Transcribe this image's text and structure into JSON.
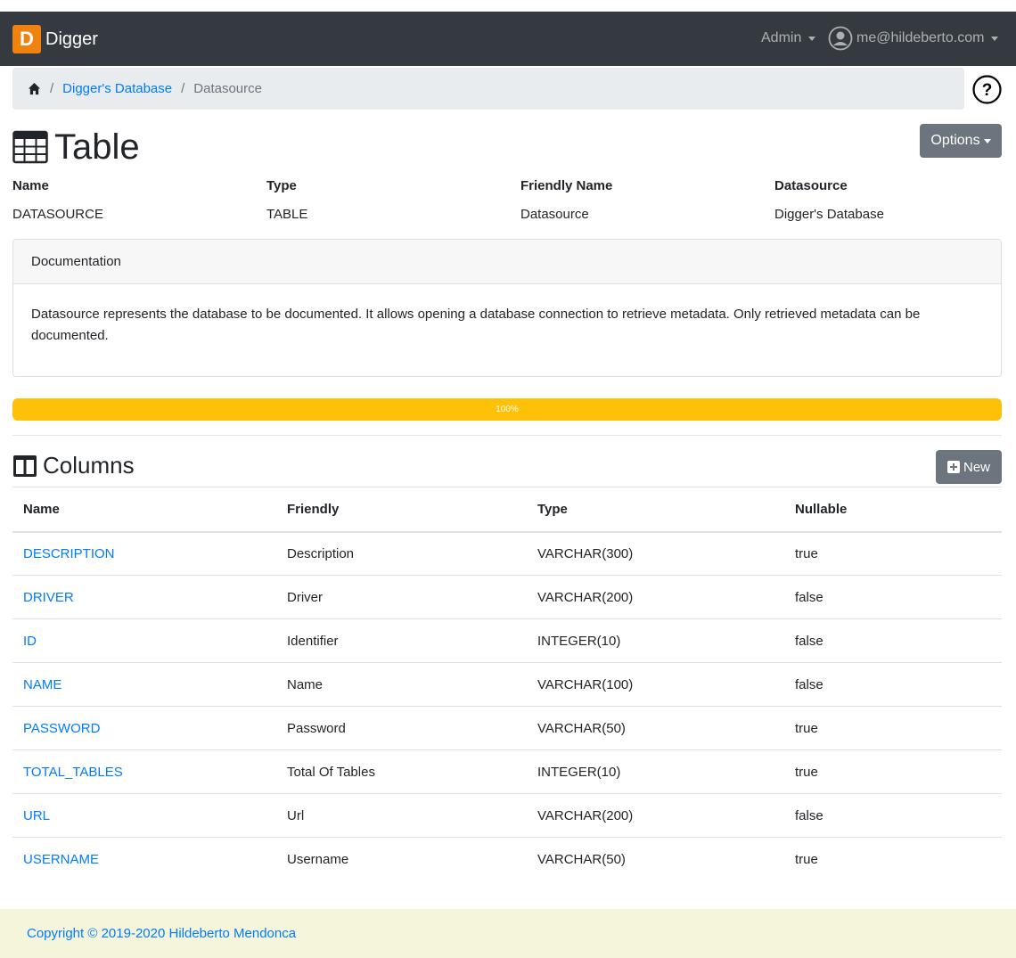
{
  "navbar": {
    "logo_letter": "D",
    "brand": "Digger",
    "admin_menu": "Admin",
    "user_email": "me@hildeberto.com"
  },
  "breadcrumb": {
    "home_icon": "home-icon",
    "items": [
      "Digger's Database",
      "Datasource"
    ]
  },
  "help_icon": "question-circle-icon",
  "page": {
    "icon": "table-icon",
    "title": "Table",
    "options_label": "Options"
  },
  "meta": {
    "fields": [
      {
        "label": "Name",
        "value": "DATASOURCE"
      },
      {
        "label": "Type",
        "value": "TABLE"
      },
      {
        "label": "Friendly Name",
        "value": "Datasource"
      },
      {
        "label": "Datasource",
        "value": "Digger's Database"
      }
    ]
  },
  "documentation": {
    "header": "Documentation",
    "body": "Datasource represents the database to be documented. It allows opening a database connection to retrieve metadata. Only retrieved metadata can be documented."
  },
  "progress": {
    "value": 100,
    "label": "100%",
    "color": "#ffc107"
  },
  "columns_section": {
    "icon": "columns-icon",
    "title": "Columns",
    "new_label": "New"
  },
  "columns_table": {
    "headers": [
      "Name",
      "Friendly",
      "Type",
      "Nullable"
    ],
    "rows": [
      [
        "DESCRIPTION",
        "Description",
        "VARCHAR(300)",
        "true"
      ],
      [
        "DRIVER",
        "Driver",
        "VARCHAR(200)",
        "false"
      ],
      [
        "ID",
        "Identifier",
        "INTEGER(10)",
        "false"
      ],
      [
        "NAME",
        "Name",
        "VARCHAR(100)",
        "false"
      ],
      [
        "PASSWORD",
        "Password",
        "VARCHAR(50)",
        "true"
      ],
      [
        "TOTAL_TABLES",
        "Total Of Tables",
        "INTEGER(10)",
        "true"
      ],
      [
        "URL",
        "Url",
        "VARCHAR(200)",
        "false"
      ],
      [
        "USERNAME",
        "Username",
        "VARCHAR(50)",
        "true"
      ]
    ]
  },
  "footer": {
    "copyright": "Copyright © 2019-2020 Hildeberto Mendonca"
  },
  "colors": {
    "navbar": "#343a40",
    "brand_logo": "#f0820f",
    "link": "#007bff",
    "secondary_button": "#6c757d",
    "footer_bg": "#f5f5dc"
  }
}
